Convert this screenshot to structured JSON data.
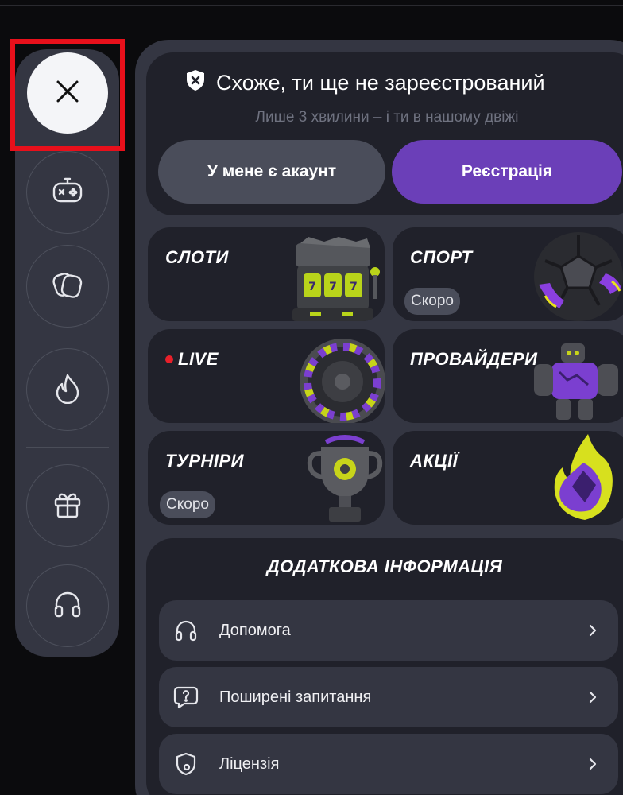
{
  "sidebar": {
    "close_icon": "close-icon",
    "items": [
      {
        "name": "gamepad-icon"
      },
      {
        "name": "cards-icon"
      },
      {
        "name": "fire-icon"
      },
      {
        "name": "gift-icon"
      },
      {
        "name": "headphones-icon"
      }
    ]
  },
  "registration": {
    "title": "Схоже, ти ще не зареєстрований",
    "subtitle": "Лише 3 хвилини – і ти в нашому двіжі",
    "login_label": "У мене є акаунт",
    "register_label": "Реєстрація",
    "accent": "#6b3fb8"
  },
  "tiles": {
    "slots": {
      "title": "СЛОТИ"
    },
    "sport": {
      "title": "СПОРТ",
      "badge": "Скоро"
    },
    "live": {
      "title": "LIVE"
    },
    "providers": {
      "title": "ПРОВАЙДЕРИ"
    },
    "tournaments": {
      "title": "ТУРНІРИ",
      "badge": "Скоро"
    },
    "promos": {
      "title": "АКЦІЇ"
    }
  },
  "info": {
    "title": "ДОДАТКОВА ІНФОРМАЦІЯ",
    "rows": [
      {
        "label": "Допомога",
        "icon": "headphones-icon"
      },
      {
        "label": "Поширені запитання",
        "icon": "question-bubble-icon"
      },
      {
        "label": "Ліцензія",
        "icon": "license-shield-icon"
      }
    ]
  }
}
